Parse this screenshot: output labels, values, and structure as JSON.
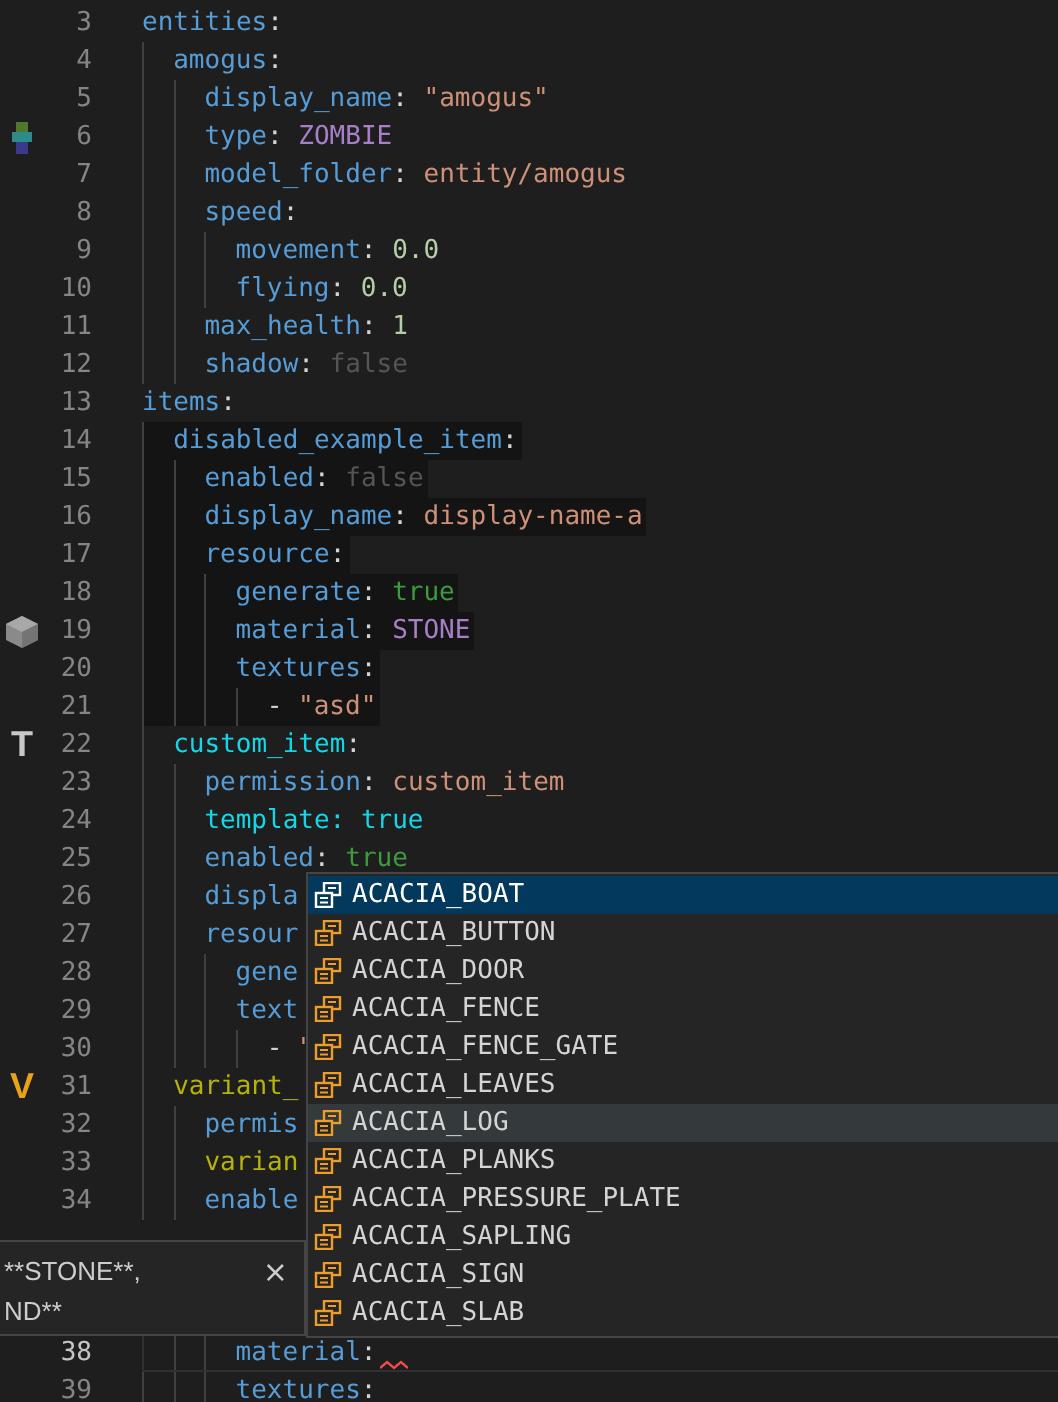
{
  "editor": {
    "lines": [
      {
        "number": "3",
        "tokens": [
          {
            "text": "entities",
            "kind": "key"
          },
          {
            "text": ":",
            "kind": "punct"
          }
        ],
        "children": [
          {
            "number": "4",
            "tokens": [
              {
                "text": "amogus",
                "kind": "key"
              },
              {
                "text": ":",
                "kind": "punct"
              }
            ],
            "children": [
              {
                "number": "5",
                "tokens": [
                  {
                    "text": "display_name",
                    "kind": "key"
                  },
                  {
                    "text": ": ",
                    "kind": "punct"
                  },
                  {
                    "text": "\"amogus\"",
                    "kind": "string"
                  }
                ]
              },
              {
                "number": "6",
                "gutter": {
                  "kind": "zombie"
                },
                "tokens": [
                  {
                    "text": "type",
                    "kind": "key"
                  },
                  {
                    "text": ": ",
                    "kind": "punct"
                  },
                  {
                    "text": "ZOMBIE",
                    "kind": "enum"
                  }
                ]
              },
              {
                "number": "7",
                "tokens": [
                  {
                    "text": "model_folder",
                    "kind": "key"
                  },
                  {
                    "text": ": ",
                    "kind": "punct"
                  },
                  {
                    "text": "entity/amogus",
                    "kind": "string"
                  }
                ]
              },
              {
                "number": "8",
                "tokens": [
                  {
                    "text": "speed",
                    "kind": "key"
                  },
                  {
                    "text": ":",
                    "kind": "punct"
                  }
                ],
                "children": [
                  {
                    "number": "9",
                    "tokens": [
                      {
                        "text": "movement",
                        "kind": "key"
                      },
                      {
                        "text": ": ",
                        "kind": "punct"
                      },
                      {
                        "text": "0.0",
                        "kind": "number"
                      }
                    ]
                  },
                  {
                    "number": "10",
                    "tokens": [
                      {
                        "text": "flying",
                        "kind": "key"
                      },
                      {
                        "text": ": ",
                        "kind": "punct"
                      },
                      {
                        "text": "0.0",
                        "kind": "number"
                      }
                    ]
                  }
                ]
              },
              {
                "number": "11",
                "tokens": [
                  {
                    "text": "max_health",
                    "kind": "key"
                  },
                  {
                    "text": ": ",
                    "kind": "punct"
                  },
                  {
                    "text": "1",
                    "kind": "number"
                  }
                ]
              },
              {
                "number": "12",
                "tokens": [
                  {
                    "text": "shadow",
                    "kind": "key"
                  },
                  {
                    "text": ": ",
                    "kind": "punct"
                  },
                  {
                    "text": "false",
                    "kind": "dim"
                  }
                ]
              }
            ]
          }
        ]
      },
      {
        "number": "13",
        "tokens": [
          {
            "text": "items",
            "kind": "key"
          },
          {
            "text": ":",
            "kind": "punct"
          }
        ],
        "children": [
          {
            "number": "14",
            "highlighted": true,
            "tokens": [
              {
                "text": "disabled_example_item",
                "kind": "key"
              },
              {
                "text": ":",
                "kind": "punct"
              }
            ],
            "children": [
              {
                "number": "15",
                "highlighted": true,
                "tokens": [
                  {
                    "text": "enabled",
                    "kind": "key"
                  },
                  {
                    "text": ": ",
                    "kind": "punct"
                  },
                  {
                    "text": "false",
                    "kind": "dim"
                  }
                ]
              },
              {
                "number": "16",
                "highlighted": true,
                "tokens": [
                  {
                    "text": "display_name",
                    "kind": "key"
                  },
                  {
                    "text": ": ",
                    "kind": "punct"
                  },
                  {
                    "text": "display-name-a",
                    "kind": "string"
                  }
                ]
              },
              {
                "number": "17",
                "highlighted": true,
                "tokens": [
                  {
                    "text": "resource",
                    "kind": "key"
                  },
                  {
                    "text": ":",
                    "kind": "punct"
                  }
                ],
                "children": [
                  {
                    "number": "18",
                    "highlighted": true,
                    "tokens": [
                      {
                        "text": "generate",
                        "kind": "key"
                      },
                      {
                        "text": ": ",
                        "kind": "punct"
                      },
                      {
                        "text": "true",
                        "kind": "bool"
                      }
                    ]
                  },
                  {
                    "number": "19",
                    "highlighted": true,
                    "gutter": {
                      "kind": "stone"
                    },
                    "tokens": [
                      {
                        "text": "material",
                        "kind": "key"
                      },
                      {
                        "text": ": ",
                        "kind": "punct"
                      },
                      {
                        "text": "STONE",
                        "kind": "enum"
                      }
                    ]
                  },
                  {
                    "number": "20",
                    "highlighted": true,
                    "tokens": [
                      {
                        "text": "textures",
                        "kind": "key"
                      },
                      {
                        "text": ":",
                        "kind": "punct"
                      }
                    ],
                    "children": [
                      {
                        "number": "21",
                        "highlighted": true,
                        "tokens": [
                          {
                            "text": "- ",
                            "kind": "punct"
                          },
                          {
                            "text": "\"asd\"",
                            "kind": "string"
                          }
                        ]
                      }
                    ]
                  }
                ]
              }
            ]
          },
          {
            "number": "22",
            "gutter": {
              "kind": "letter",
              "text": "T",
              "color": "#c8c8c8"
            },
            "tokens": [
              {
                "text": "custom_item",
                "kind": "key-cyan"
              },
              {
                "text": ":",
                "kind": "punct"
              }
            ],
            "children": [
              {
                "number": "23",
                "tokens": [
                  {
                    "text": "permission",
                    "kind": "key"
                  },
                  {
                    "text": ": ",
                    "kind": "punct"
                  },
                  {
                    "text": "custom_item",
                    "kind": "string"
                  }
                ]
              },
              {
                "number": "24",
                "tokens": [
                  {
                    "text": "template: true",
                    "kind": "key-cyan"
                  }
                ]
              },
              {
                "number": "25",
                "tokens": [
                  {
                    "text": "enabled",
                    "kind": "key"
                  },
                  {
                    "text": ": ",
                    "kind": "punct"
                  },
                  {
                    "text": "true",
                    "kind": "bool"
                  }
                ]
              },
              {
                "number": "26",
                "tokens": [
                  {
                    "text": "displa",
                    "kind": "key"
                  }
                ]
              },
              {
                "number": "27",
                "tokens": [
                  {
                    "text": "resour",
                    "kind": "key"
                  }
                ],
                "children": [
                  {
                    "number": "28",
                    "tokens": [
                      {
                        "text": "gene",
                        "kind": "key"
                      }
                    ]
                  },
                  {
                    "number": "29",
                    "tokens": [
                      {
                        "text": "text",
                        "kind": "key"
                      }
                    ],
                    "children": [
                      {
                        "number": "30",
                        "tokens": [
                          {
                            "text": "- ",
                            "kind": "punct"
                          },
                          {
                            "text": "\"",
                            "kind": "string"
                          }
                        ]
                      }
                    ]
                  }
                ]
              }
            ]
          },
          {
            "number": "31",
            "gutter": {
              "kind": "letter",
              "text": "V",
              "color": "#e8a317"
            },
            "tokens": [
              {
                "text": "variant_",
                "kind": "key-olive"
              }
            ],
            "children": [
              {
                "number": "32",
                "tokens": [
                  {
                    "text": "permis",
                    "kind": "key"
                  }
                ]
              },
              {
                "number": "33",
                "tokens": [
                  {
                    "text": "varian",
                    "kind": "key-olive"
                  }
                ]
              },
              {
                "number": "34",
                "tokens": [
                  {
                    "text": "enable",
                    "kind": "key"
                  }
                ]
              }
            ]
          }
        ]
      }
    ],
    "lines_below": [
      {
        "children": [
          {
            "children": [
              {
                "children": [
                  {
                    "number": "38",
                    "current": true,
                    "error": true,
                    "tokens": [
                      {
                        "text": "material",
                        "kind": "key"
                      },
                      {
                        "text": ":",
                        "kind": "punct"
                      }
                    ]
                  },
                  {
                    "number": "39",
                    "tokens": [
                      {
                        "text": "textures",
                        "kind": "key"
                      },
                      {
                        "text": ":",
                        "kind": "punct"
                      }
                    ]
                  }
                ]
              }
            ]
          }
        ]
      }
    ]
  },
  "hover": {
    "lines": [
      "**STONE**,",
      "ND**"
    ],
    "close": "×"
  },
  "completion": {
    "items": [
      {
        "label": "ACACIA_BOAT",
        "selected": true,
        "hovered": false
      },
      {
        "label": "ACACIA_BUTTON",
        "selected": false,
        "hovered": false
      },
      {
        "label": "ACACIA_DOOR",
        "selected": false,
        "hovered": false
      },
      {
        "label": "ACACIA_FENCE",
        "selected": false,
        "hovered": false
      },
      {
        "label": "ACACIA_FENCE_GATE",
        "selected": false,
        "hovered": false
      },
      {
        "label": "ACACIA_LEAVES",
        "selected": false,
        "hovered": false
      },
      {
        "label": "ACACIA_LOG",
        "selected": false,
        "hovered": true
      },
      {
        "label": "ACACIA_PLANKS",
        "selected": false,
        "hovered": false
      },
      {
        "label": "ACACIA_PRESSURE_PLATE",
        "selected": false,
        "hovered": false
      },
      {
        "label": "ACACIA_SAPLING",
        "selected": false,
        "hovered": false
      },
      {
        "label": "ACACIA_SIGN",
        "selected": false,
        "hovered": false
      },
      {
        "label": "ACACIA_SLAB",
        "selected": false,
        "hovered": false
      }
    ]
  }
}
